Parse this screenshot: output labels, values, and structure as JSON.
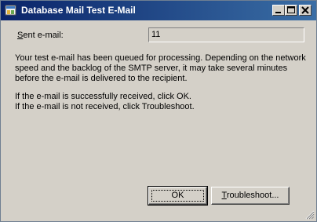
{
  "window": {
    "title": "Database Mail Test E-Mail",
    "icon": "database-mail-icon",
    "controls": {
      "minimize": "minimize-icon",
      "maximize": "maximize-icon",
      "close": "close-icon"
    }
  },
  "form": {
    "sent_label_first": "S",
    "sent_label_rest": "ent e-mail:",
    "sent_value": "11"
  },
  "message": {
    "line1": "Your test e-mail has been queued for processing.  Depending on the network",
    "line2": "speed and the backlog of the SMTP server, it may take several minutes",
    "line3": "before the e-mail is delivered to the recipient.",
    "line4": "If the e-mail is successfully received, click OK.",
    "line5": "If the e-mail is not received, click Troubleshoot."
  },
  "buttons": {
    "ok_label": "OK",
    "troubleshoot_first": "T",
    "troubleshoot_rest": "roubleshoot..."
  },
  "colors": {
    "titlebar_start": "#0a246a",
    "titlebar_end": "#3a6ea5",
    "dialog_bg": "#d4d0c8"
  }
}
